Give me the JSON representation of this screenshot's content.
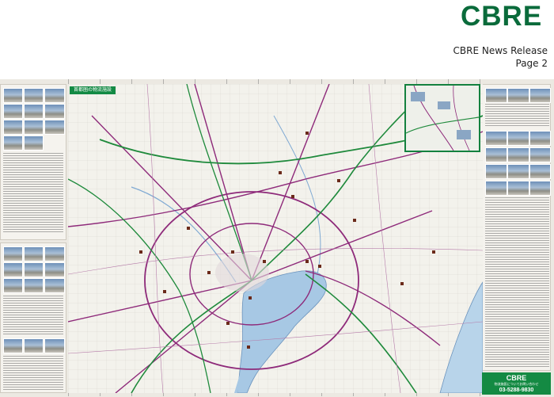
{
  "header": {
    "logo": "CBRE",
    "release_title": "CBRE News Release",
    "page_label": "Page 2"
  },
  "map": {
    "title": "首都圏の物流施設",
    "water_color": "#a7c8e4",
    "road_color": "#8e2a7a",
    "expressway_color": "#1f8a3c"
  },
  "contact_box": {
    "brand": "CBRE",
    "line": "物流施設についてお問い合わせ",
    "phone": "03-5288-9830"
  },
  "colors": {
    "brand_green": "#0a6b3b",
    "panel_bg": "#f5f3ee"
  }
}
